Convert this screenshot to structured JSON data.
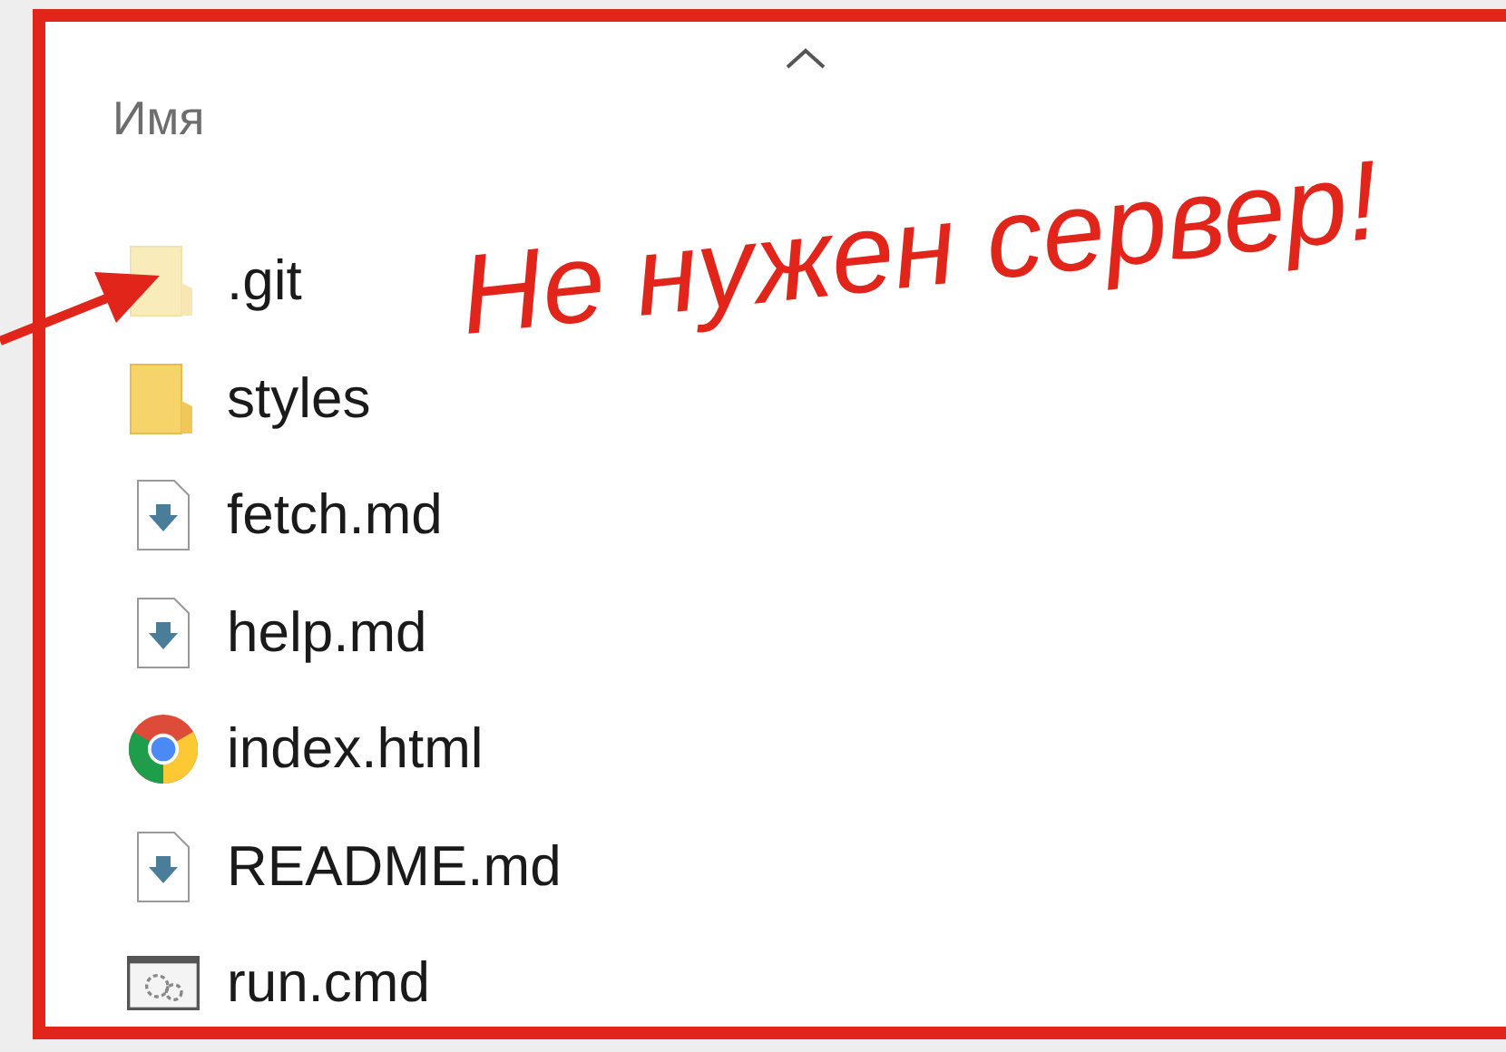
{
  "column_header": {
    "label": "Имя",
    "sort_ascending": true
  },
  "files": [
    {
      "name": ".git",
      "kind": "folder",
      "hidden": true
    },
    {
      "name": "styles",
      "kind": "folder",
      "hidden": false
    },
    {
      "name": "fetch.md",
      "kind": "markdown",
      "hidden": false
    },
    {
      "name": "help.md",
      "kind": "markdown",
      "hidden": false
    },
    {
      "name": "index.html",
      "kind": "browser",
      "hidden": false
    },
    {
      "name": "README.md",
      "kind": "markdown",
      "hidden": false
    },
    {
      "name": "run.cmd",
      "kind": "script",
      "hidden": false
    }
  ],
  "annotation": {
    "text": "Не нужен сервер!"
  }
}
